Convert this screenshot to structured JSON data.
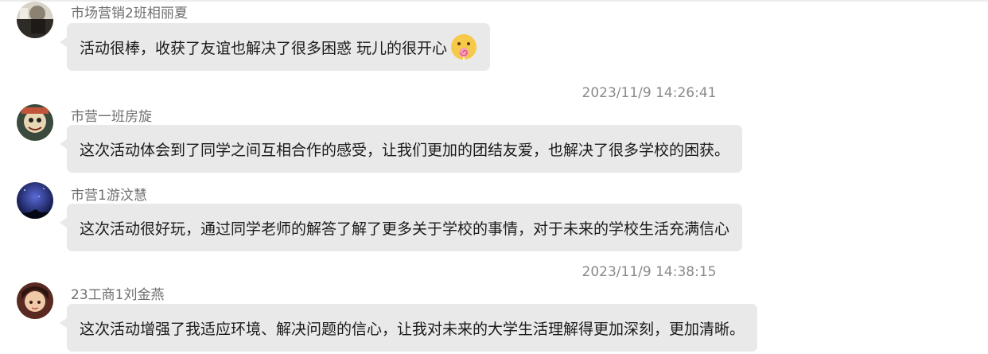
{
  "messages": [
    {
      "sender": "市场营销2班相丽夏",
      "text": "活动很棒，收获了友谊也解决了很多困惑  玩儿的很开心",
      "emoji_icon": "lollipop-face-emoji"
    },
    {
      "sender": "市营一班房旋",
      "text": "这次活动体会到了同学之间互相合作的感受，让我们更加的团结友爱，也解决了很多学校的困获。"
    },
    {
      "sender": "市营1游汶慧",
      "text": "这次活动很好玩，通过同学老师的解答了解了更多关于学校的事情，对于未来的学校生活充满信心"
    },
    {
      "sender": "23工商1刘金燕",
      "text": "这次活动增强了我适应环境、解决问题的信心，让我对未来的大学生活理解得更加深刻，更加清晰。"
    }
  ],
  "timestamps": [
    "2023/11/9 14:26:41",
    "2023/11/9 14:38:15"
  ],
  "colors": {
    "bubble": "#e9e9e9",
    "sender_text": "#6f6f6f",
    "message_text": "#1b1b1b",
    "timestamp_text": "#8a8a8a"
  }
}
